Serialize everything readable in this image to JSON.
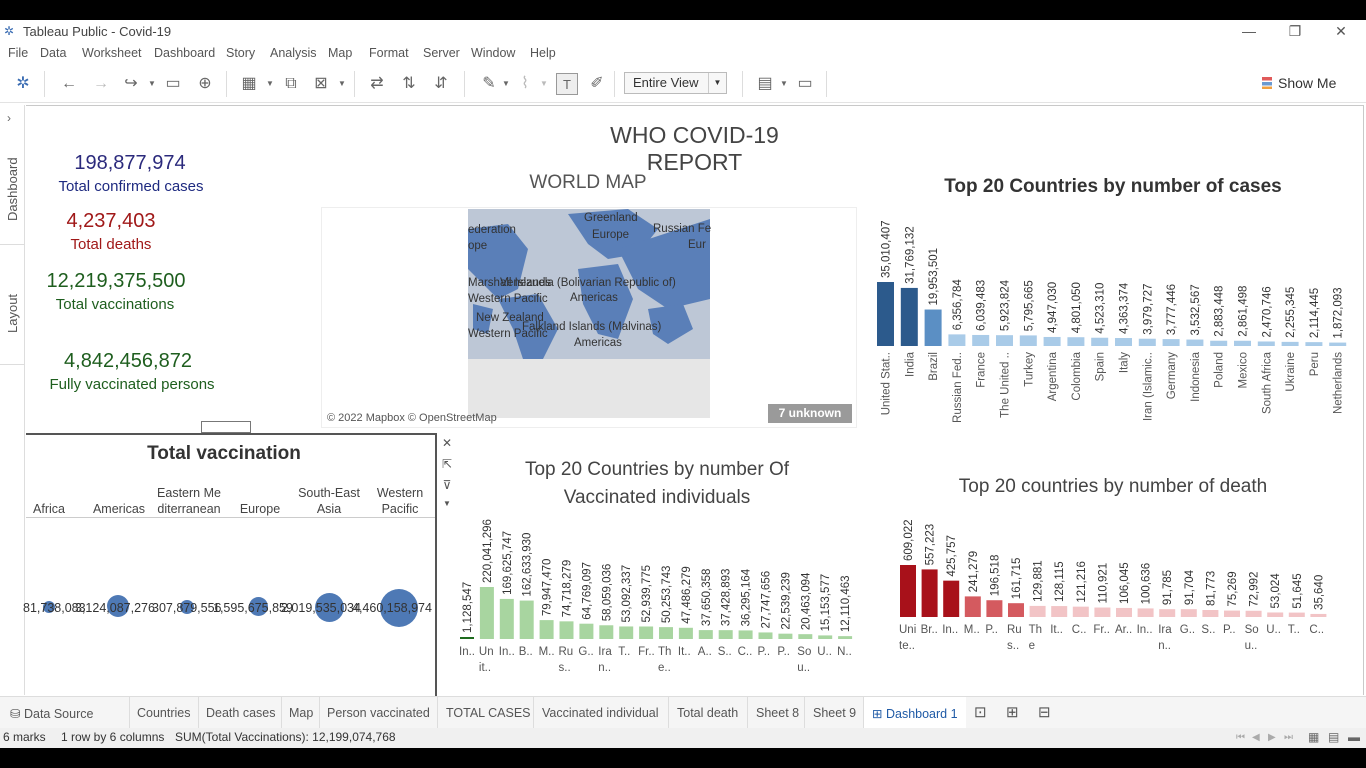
{
  "window": {
    "title": "Tableau Public - Covid-19",
    "minimize": "—",
    "maximize": "❐",
    "close": "✕"
  },
  "menu": [
    "File",
    "Data",
    "Worksheet",
    "Dashboard",
    "Story",
    "Analysis",
    "Map",
    "Format",
    "Server",
    "Window",
    "Help"
  ],
  "toolbar": {
    "view_select": "Entire View",
    "show_me": "Show Me"
  },
  "side_tabs": {
    "dashboard": "Dashboard",
    "layout": "Layout"
  },
  "dashboard": {
    "title": "WHO COVID-19 REPORT",
    "kpis": {
      "confirmed_value": "198,877,974",
      "confirmed_label": "Total confirmed cases",
      "deaths_value": "4,237,403",
      "deaths_label": "Total deaths",
      "vaccinations_value": "12,219,375,500",
      "vaccinations_label": "Total vaccinations",
      "fully_value": "4,842,456,872",
      "fully_label": "Fully vaccinated persons"
    },
    "map": {
      "title": "WORLD MAP",
      "credit": "© 2022 Mapbox © OpenStreetMap",
      "unknown_badge": "7 unknown",
      "labels": [
        "ederation",
        "ope",
        "Greenland",
        "Europe",
        "Russian Fe",
        "Eur",
        "Marshall Islands",
        "Venezuela (Bolivarian Republic of)",
        "Western Pacific",
        "Americas",
        "New Zealand",
        "Western Pacific",
        "Falkland Islands (Malvinas)",
        "Americas"
      ]
    },
    "vaccination_panel": {
      "title": "Total vaccination",
      "regions": [
        "Africa",
        "Americas",
        "Eastern Me diterranean",
        "Europe",
        "South-East Asia",
        "Western Pacific"
      ],
      "values": [
        "81,738,083",
        "3,124,087,276",
        "307,879,556",
        "1,595,675,859",
        "2,019,535,034",
        "4,460,158,974"
      ],
      "bubble_color": "#4e79b5"
    }
  },
  "chart_data": [
    {
      "type": "bar",
      "title": "Top 20 Countries by number of cases",
      "categories": [
        "United Stat..",
        "India",
        "Brazil",
        "Russian Fed..",
        "France",
        "The United ..",
        "Turkey",
        "Argentina",
        "Colombia",
        "Spain",
        "Italy",
        "Iran (Islamic..",
        "Germany",
        "Indonesia",
        "Poland",
        "Mexico",
        "South Africa",
        "Ukraine",
        "Peru",
        "Netherlands"
      ],
      "values": [
        35010407,
        31769132,
        19953501,
        6356784,
        6039483,
        5923824,
        5795665,
        4947030,
        4801050,
        4523310,
        4363374,
        3979727,
        3777446,
        3532567,
        2883448,
        2861498,
        2470746,
        2255345,
        2114445,
        1872093
      ],
      "value_labels": [
        "35,010,407",
        "31,769,132",
        "19,953,501",
        "6,356,784",
        "6,039,483",
        "5,923,824",
        "5,795,665",
        "4,947,030",
        "4,801,050",
        "4,523,310",
        "4,363,374",
        "3,979,727",
        "3,777,446",
        "3,532,567",
        "2,883,448",
        "2,861,498",
        "2,470,746",
        "2,255,345",
        "2,114,445",
        "1,872,093"
      ],
      "colors": {
        "high": "#2c5a8c",
        "mid": "#5b8fc4",
        "low": "#a9cbe8"
      }
    },
    {
      "type": "bar",
      "title": "Top 20 Countries by number Of Vaccinated individuals",
      "categories": [
        "In..",
        "Un it..",
        "In..",
        "B..",
        "M..",
        "Ru s..",
        "G..",
        "Ira n..",
        "T..",
        "Fr..",
        "Th e..",
        "It..",
        "A..",
        "S..",
        "C..",
        "P..",
        "P..",
        "So u..",
        "U..",
        "N.."
      ],
      "values": [
        1128547,
        220041296,
        169625747,
        162633930,
        79947470,
        74718279,
        64769097,
        58059036,
        53092337,
        52939775,
        50253743,
        47486279,
        37650358,
        37428893,
        36295164,
        27747656,
        22539239,
        20463094,
        15153577,
        12110463
      ],
      "value_labels": [
        "1,128,547",
        "220,041,296",
        "169,625,747",
        "162,633,930",
        "79,947,470",
        "74,718,279",
        "64,769,097",
        "58,059,036",
        "53,092,337",
        "52,939,775",
        "50,253,743",
        "47,486,279",
        "37,650,358",
        "37,428,893",
        "36,295,164",
        "27,747,656",
        "22,539,239",
        "20,463,094",
        "15,153,577",
        "12,110,463"
      ],
      "colors": {
        "selected": "#1e6b1e",
        "bar": "#a8d5a0"
      }
    },
    {
      "type": "bar",
      "title": "Top 20 countries by number of death",
      "categories": [
        "Uni te..",
        "Br..",
        "In..",
        "M..",
        "P..",
        "Ru s..",
        "Th e",
        "It..",
        "C..",
        "Fr..",
        "Ar..",
        "In..",
        "Ira n..",
        "G..",
        "S..",
        "P..",
        "So u..",
        "U..",
        "T..",
        "C.."
      ],
      "values": [
        609022,
        557223,
        425757,
        241279,
        196518,
        161715,
        129881,
        128115,
        121216,
        110921,
        106045,
        100636,
        91785,
        91704,
        81773,
        75269,
        72992,
        53024,
        51645,
        35640
      ],
      "value_labels": [
        "609,022",
        "557,223",
        "425,757",
        "241,279",
        "196,518",
        "161,715",
        "129,881",
        "128,115",
        "121,216",
        "110,921",
        "106,045",
        "100,636",
        "91,785",
        "91,704",
        "81,773",
        "75,269",
        "72,992",
        "53,024",
        "51,645",
        "35,640"
      ],
      "colors": {
        "high": "#a8111a",
        "mid": "#d45a5f",
        "low": "#f2c4c6"
      }
    }
  ],
  "sheet_tabs": {
    "data_source": "Data Source",
    "tabs": [
      "Countries",
      "Death cases",
      "Map",
      "Person vaccinated",
      "TOTAL CASES",
      "Vaccinated individual",
      "Total death",
      "Sheet 8",
      "Sheet 9"
    ],
    "active": "Dashboard 1"
  },
  "status": {
    "marks": "6 marks",
    "rows_cols": "1 row by 6 columns",
    "sum": "SUM(Total Vaccinations): 12,199,074,768"
  }
}
